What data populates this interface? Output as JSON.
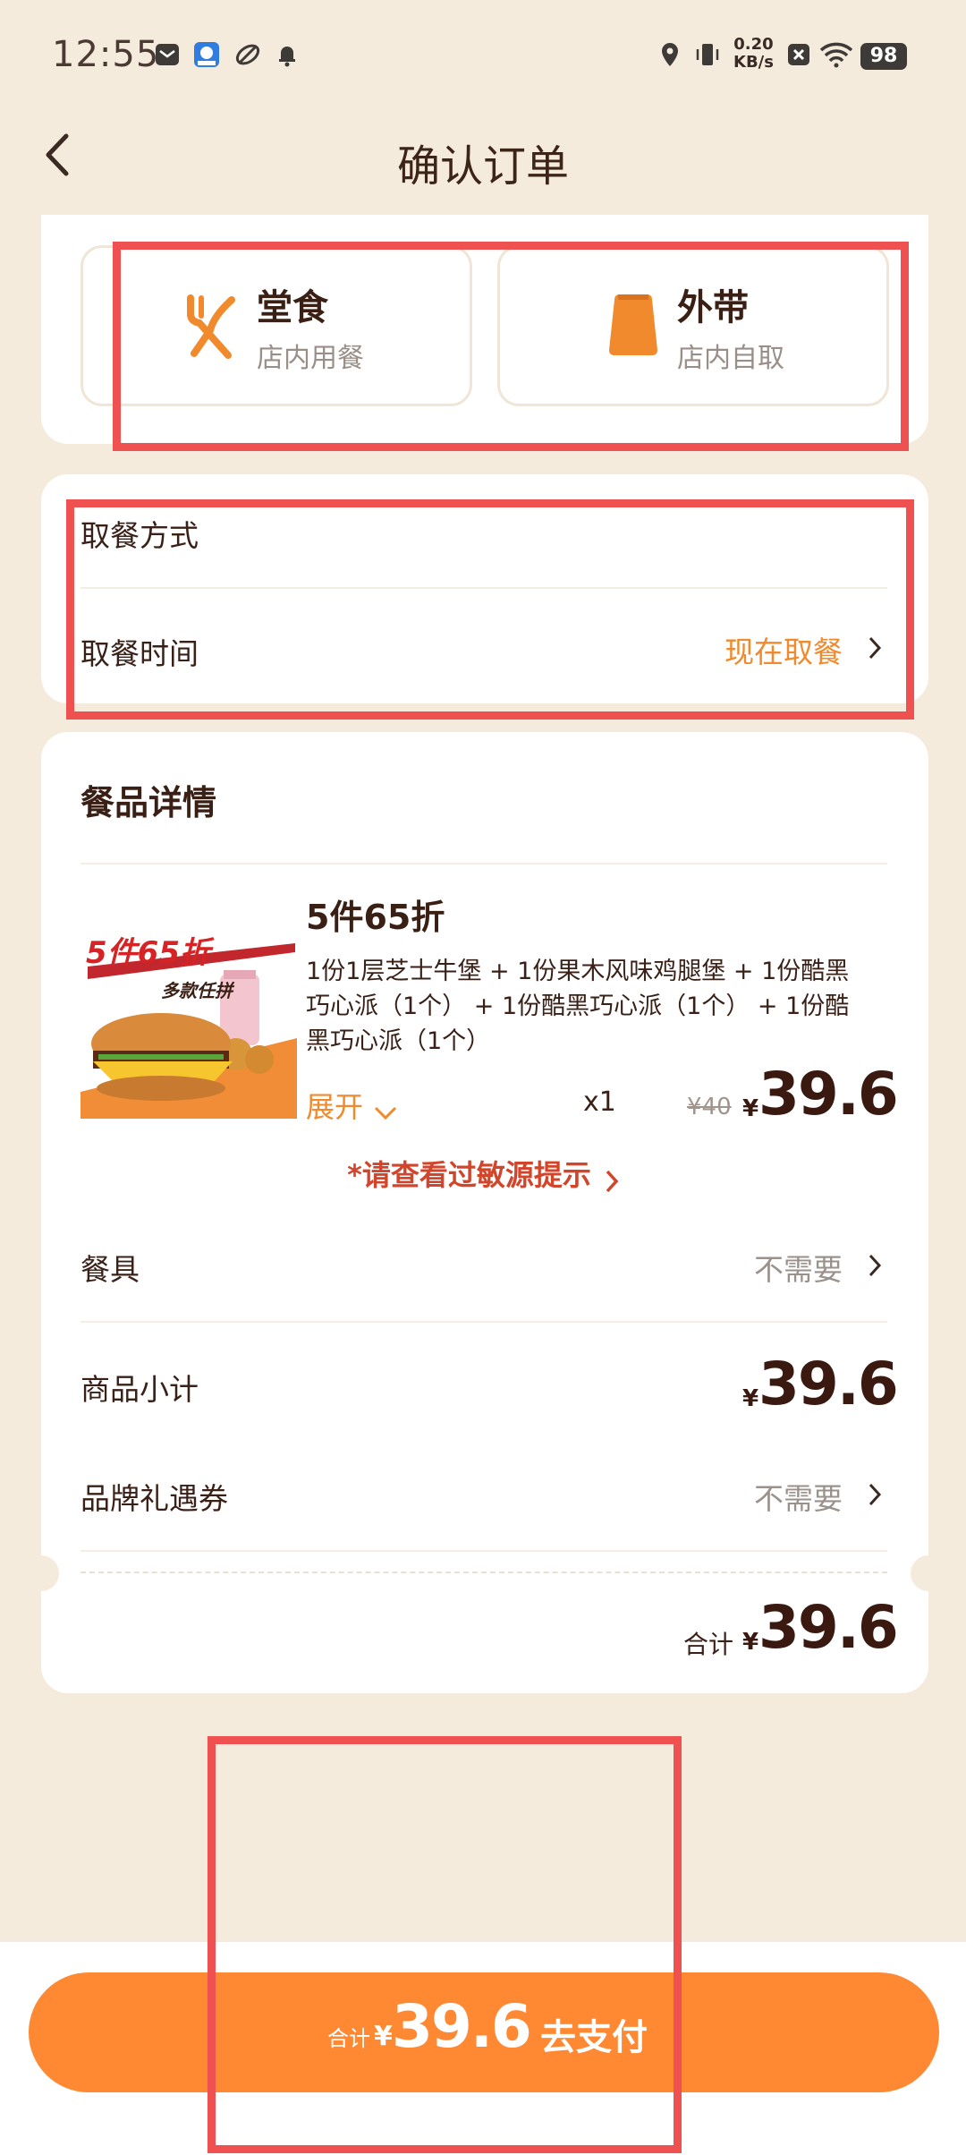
{
  "status_bar": {
    "time": "12:55",
    "speed_top": "0.20",
    "speed_bottom": "KB/s",
    "battery": "98"
  },
  "header": {
    "title": "确认订单"
  },
  "dining": {
    "dine_in": {
      "title": "堂食",
      "sub": "店内用餐"
    },
    "takeaway": {
      "title": "外带",
      "sub": "店内自取"
    }
  },
  "pickup": {
    "method_label": "取餐方式",
    "time_label": "取餐时间",
    "time_value": "现在取餐"
  },
  "details": {
    "title": "餐品详情",
    "promo_image_text": {
      "main": "5件65折",
      "sub": "多款任拼"
    },
    "item": {
      "name": "5件65折",
      "desc_lines": [
        "1份1层芝士牛堡 + 1份果木风味鸡腿堡 + 1份酷黑",
        "巧心派（1个） + 1份酷黑巧心派（1个） + 1份酷",
        "黑巧心派（1个）"
      ],
      "expand_label": "展开",
      "quantity": "x1",
      "original_price": "¥40",
      "price_symbol": "¥",
      "price": "39.6"
    },
    "allergen_link": "*请查看过敏源提示",
    "utensils": {
      "label": "餐具",
      "value": "不需要"
    },
    "subtotal": {
      "label": "商品小计",
      "symbol": "¥",
      "value": "39.6"
    },
    "coupon": {
      "label": "品牌礼遇券",
      "value": "不需要"
    },
    "total": {
      "label": "合计",
      "symbol": "¥",
      "value": "39.6"
    }
  },
  "pay_button": {
    "total_label": "合计",
    "symbol": "¥",
    "amount": "39.6",
    "action": "去支付"
  },
  "colors": {
    "accent": "#ff8833",
    "highlight": "#ef5050",
    "background": "#f5ebdc"
  }
}
